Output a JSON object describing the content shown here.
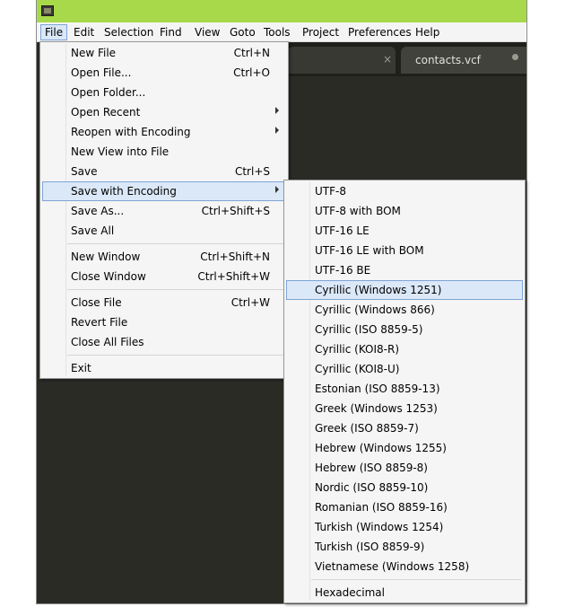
{
  "menubar": {
    "items": [
      "File",
      "Edit",
      "Selection",
      "Find",
      "View",
      "Goto",
      "Tools",
      "Project",
      "Preferences",
      "Help"
    ]
  },
  "tabs": {
    "first_close_glyph": "×",
    "active_label": "contacts.vcf"
  },
  "file_menu": {
    "items": [
      {
        "label": "New File",
        "shortcut": "Ctrl+N"
      },
      {
        "label": "Open File...",
        "shortcut": "Ctrl+O"
      },
      {
        "label": "Open Folder...",
        "shortcut": ""
      },
      {
        "label": "Open Recent",
        "shortcut": "",
        "submenu": true
      },
      {
        "label": "Reopen with Encoding",
        "shortcut": "",
        "submenu": true
      },
      {
        "label": "New View into File",
        "shortcut": ""
      },
      {
        "label": "Save",
        "shortcut": "Ctrl+S"
      },
      {
        "label": "Save with Encoding",
        "shortcut": "",
        "submenu": true,
        "highlighted": true
      },
      {
        "label": "Save As...",
        "shortcut": "Ctrl+Shift+S"
      },
      {
        "label": "Save All",
        "shortcut": ""
      },
      {
        "label": "New Window",
        "shortcut": "Ctrl+Shift+N"
      },
      {
        "label": "Close Window",
        "shortcut": "Ctrl+Shift+W"
      },
      {
        "label": "Close File",
        "shortcut": "Ctrl+W"
      },
      {
        "label": "Revert File",
        "shortcut": ""
      },
      {
        "label": "Close All Files",
        "shortcut": ""
      },
      {
        "label": "Exit",
        "shortcut": ""
      }
    ]
  },
  "encoding_menu": {
    "items": [
      "UTF-8",
      "UTF-8 with BOM",
      "UTF-16 LE",
      "UTF-16 LE with BOM",
      "UTF-16 BE",
      "Cyrillic (Windows 1251)",
      "Cyrillic (Windows 866)",
      "Cyrillic (ISO 8859-5)",
      "Cyrillic (KOI8-R)",
      "Cyrillic (KOI8-U)",
      "Estonian (ISO 8859-13)",
      "Greek (Windows 1253)",
      "Greek (ISO 8859-7)",
      "Hebrew (Windows 1255)",
      "Hebrew (ISO 8859-8)",
      "Nordic (ISO 8859-10)",
      "Romanian (ISO 8859-16)",
      "Turkish (Windows 1254)",
      "Turkish (ISO 8859-9)",
      "Vietnamese (Windows 1258)",
      "Hexadecimal"
    ],
    "highlighted": "Cyrillic (Windows 1251)"
  },
  "colors": {
    "titlebar": "#a8d94a",
    "editor_bg": "#2b2b26",
    "menu_bg": "#f5f5f5",
    "highlight_bg": "#dbe8f8",
    "highlight_border": "#7ea4d6"
  }
}
